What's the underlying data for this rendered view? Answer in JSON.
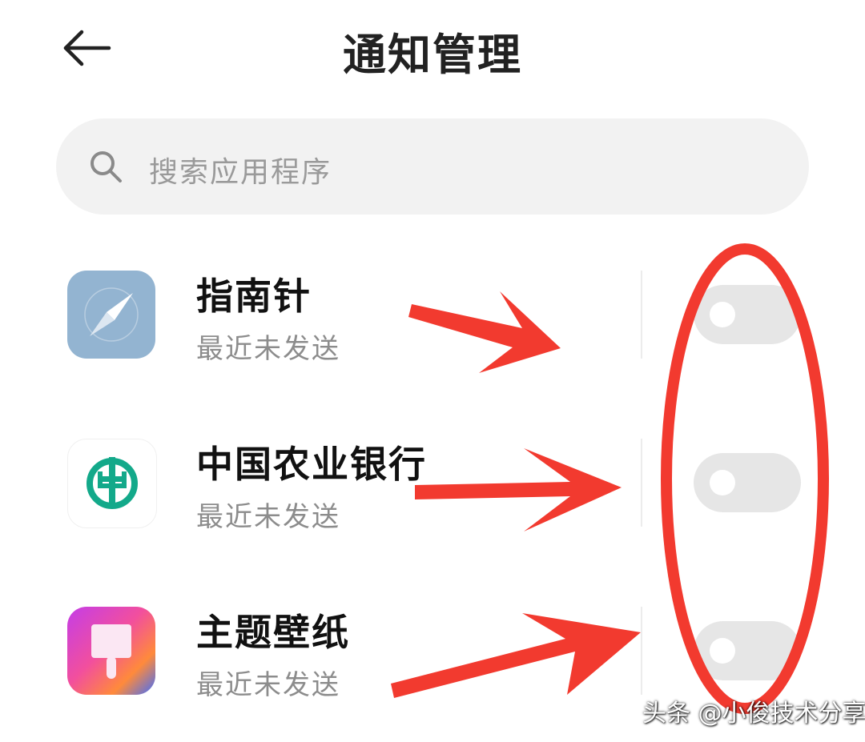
{
  "header": {
    "title": "通知管理"
  },
  "search": {
    "placeholder": "搜索应用程序"
  },
  "apps": [
    {
      "name": "指南针",
      "status": "最近未发送",
      "enabled": false
    },
    {
      "name": "中国农业银行",
      "status": "最近未发送",
      "enabled": false
    },
    {
      "name": "主题壁纸",
      "status": "最近未发送",
      "enabled": false
    }
  ],
  "icons": {
    "back": "back-arrow-icon",
    "search": "search-icon",
    "app_0": "compass-app-icon",
    "app_1": "abc-bank-app-icon",
    "app_2": "theme-wallpaper-app-icon"
  },
  "colors": {
    "annotation": "#f23a2f",
    "toggle_off": "#e6e6e6",
    "compass_bg": "#93b4d1",
    "abc_green": "#13a98a"
  },
  "watermark": {
    "text": "头条 @小俊技术分享"
  }
}
